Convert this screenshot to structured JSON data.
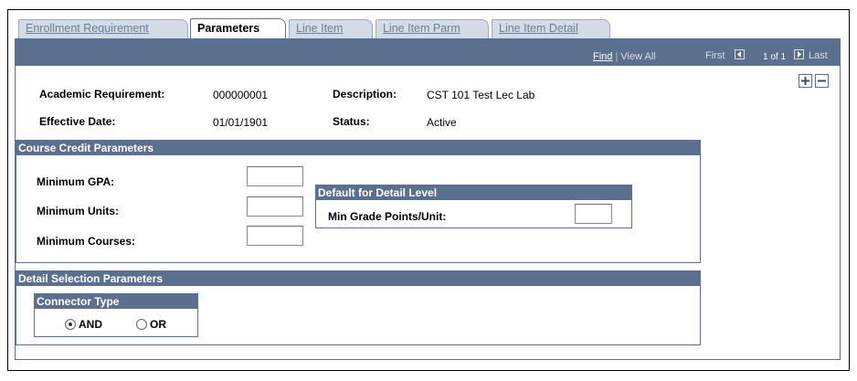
{
  "tabs": [
    {
      "label": "Enrollment Requirement",
      "active": false
    },
    {
      "label": "Parameters",
      "active": true
    },
    {
      "label": "Line Item",
      "active": false
    },
    {
      "label": "Line Item Parm",
      "active": false
    },
    {
      "label": "Line Item Detail",
      "active": false
    }
  ],
  "navbar": {
    "find": "Find",
    "separator": "|",
    "view_all": "View All",
    "first": "First",
    "count": "1 of 1",
    "last": "Last"
  },
  "row_buttons": {
    "add": "+",
    "delete": "−"
  },
  "header_fields": {
    "academic_requirement_label": "Academic Requirement:",
    "academic_requirement_value": "000000001",
    "description_label": "Description:",
    "description_value": "CST 101  Test Lec Lab",
    "effective_date_label": "Effective Date:",
    "effective_date_value": "01/01/1901",
    "status_label": "Status:",
    "status_value": "Active"
  },
  "course_credit": {
    "title": "Course Credit Parameters",
    "min_gpa_label": "Minimum GPA:",
    "min_gpa_value": "",
    "min_units_label": "Minimum Units:",
    "min_units_value": "",
    "min_courses_label": "Minimum Courses:",
    "min_courses_value": ""
  },
  "detail_level": {
    "title": "Default for Detail Level",
    "min_grade_points_label": "Min Grade Points/Unit:",
    "min_grade_points_value": ""
  },
  "detail_selection": {
    "title": "Detail Selection Parameters",
    "connector": {
      "title": "Connector Type",
      "options": [
        {
          "label": "AND",
          "selected": true
        },
        {
          "label": "OR",
          "selected": false
        }
      ]
    }
  },
  "colors": {
    "header_blue": "#5b6f8f",
    "tab_inactive": "#d3dbe6"
  }
}
